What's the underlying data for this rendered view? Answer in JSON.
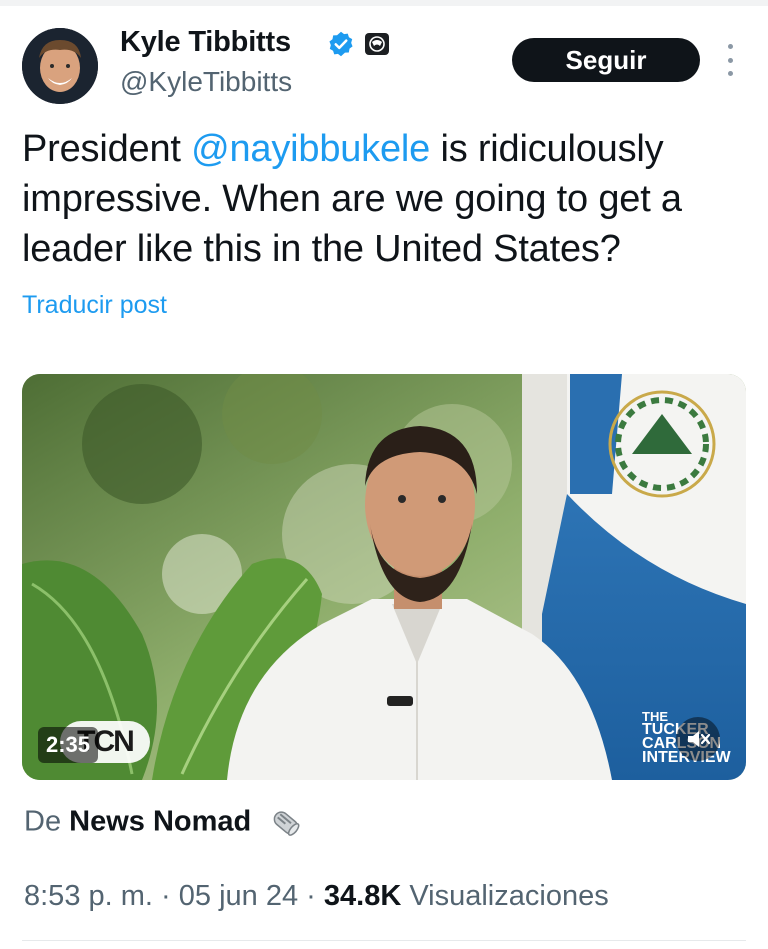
{
  "author": {
    "name": "Kyle Tibbitts",
    "handle": "@KyleTibbitts",
    "verified": true,
    "verified_color": "#1d9bf0"
  },
  "actions": {
    "follow_label": "Seguir",
    "more_icon": "more-vertical-icon"
  },
  "tweet": {
    "text_before": "President ",
    "mention": "@nayibbukele",
    "text_after": " is ridiculously impressive. When are we going to get a leader like this in the United States?",
    "translate_label": "Traducir post"
  },
  "media": {
    "duration": "2:35",
    "watermark_left": "TCN",
    "watermark_right": [
      "THE",
      "TUCKER",
      "CARLSON",
      "INTERVIEW"
    ],
    "mute_icon": "speaker-muted-icon"
  },
  "source": {
    "prefix": "De",
    "name": "News Nomad",
    "emoji_icon": "newspaper-roll-icon"
  },
  "meta": {
    "time": "8:53 p. m.",
    "date": "05 jun 24",
    "views_count": "34.8K",
    "views_label": "Visualizaciones"
  },
  "colors": {
    "accent": "#1d9bf0",
    "text": "#0f1419",
    "muted": "#536471"
  }
}
